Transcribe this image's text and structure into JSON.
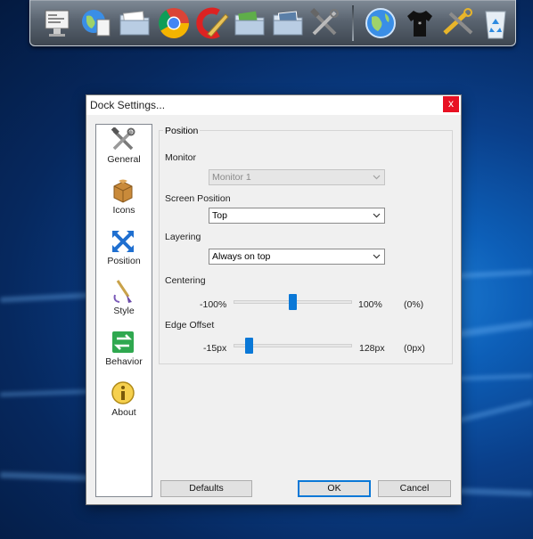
{
  "dock": {
    "icons": [
      "document-icon",
      "web-icon",
      "folder-icon",
      "chrome-icon",
      "ccleaner-icon",
      "green-folder-icon",
      "pictures-folder-icon",
      "tools-icon",
      "globe-icon",
      "tshirt-icon",
      "settings-tools-icon",
      "recycle-bin-icon"
    ]
  },
  "dialog": {
    "title": "Dock Settings...",
    "close_label": "x"
  },
  "nav": {
    "items": [
      {
        "label": "General",
        "icon": "tools-icon"
      },
      {
        "label": "Icons",
        "icon": "box-icon"
      },
      {
        "label": "Position",
        "icon": "move-arrows-icon"
      },
      {
        "label": "Style",
        "icon": "paintbrush-icon"
      },
      {
        "label": "Behavior",
        "icon": "exchange-icon"
      },
      {
        "label": "About",
        "icon": "info-icon"
      }
    ]
  },
  "position": {
    "group_title": "Position",
    "monitor_label": "Monitor",
    "monitor_value": "Monitor 1",
    "screen_position_label": "Screen Position",
    "screen_position_value": "Top",
    "layering_label": "Layering",
    "layering_value": "Always on top",
    "centering_label": "Centering",
    "centering_min": "-100%",
    "centering_max": "100%",
    "centering_current": "(0%)",
    "centering_fraction": 0.5,
    "edge_offset_label": "Edge Offset",
    "edge_offset_min": "-15px",
    "edge_offset_max": "128px",
    "edge_offset_current": "(0px)",
    "edge_offset_fraction": 0.105
  },
  "buttons": {
    "defaults": "Defaults",
    "ok": "OK",
    "cancel": "Cancel"
  },
  "colors": {
    "accent": "#0a78d7",
    "close": "#e81123"
  }
}
